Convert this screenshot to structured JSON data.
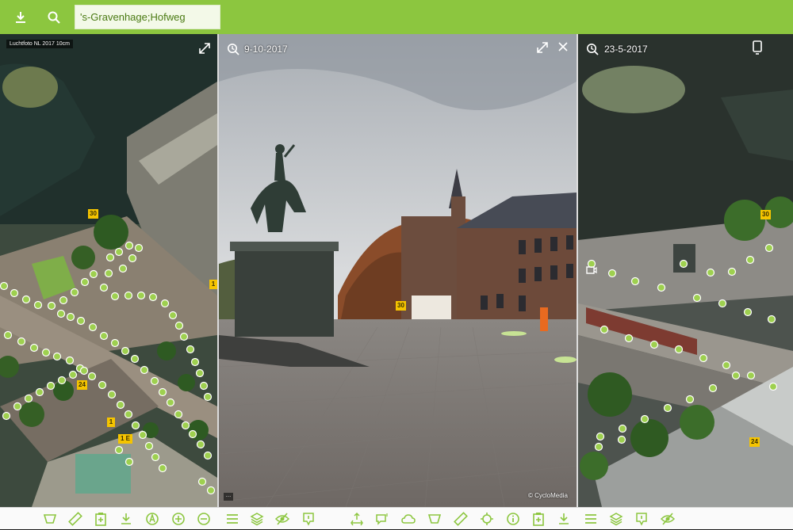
{
  "search": {
    "value": "'s-Gravenhage;Hofweg"
  },
  "left_pane": {
    "layer_label": "Luchtfoto NL 2017 10cm",
    "badges": [
      "30",
      "24",
      "1",
      "1 E",
      "1"
    ]
  },
  "middle_pane": {
    "date": "9-10-2017",
    "copyright": "© CycloMedia",
    "badge": "30"
  },
  "right_pane": {
    "date": "23-5-2017",
    "badges": [
      "30",
      "24"
    ]
  },
  "colors": {
    "accent": "#8cc63f",
    "marker": "#9ed04f",
    "badge": "#f5c400"
  },
  "toolbar": {
    "top_icons": [
      "download-icon",
      "search-icon"
    ],
    "left_icons": [
      "area-measure-icon",
      "ruler-icon",
      "clipboard-icon",
      "download-icon",
      "compass-icon",
      "zoom-in-icon",
      "zoom-out-icon"
    ],
    "middle_icons": [
      "menu-icon",
      "layers-icon",
      "visibility-off-icon",
      "annotation-icon",
      "pan-icon",
      "comment-icon",
      "cloud-icon",
      "area-measure-icon",
      "ruler-icon",
      "locate-icon",
      "info-icon",
      "clipboard-icon",
      "download-icon"
    ],
    "right_icons": [
      "menu-icon",
      "layers-icon",
      "annotation-icon",
      "visibility-off-icon"
    ]
  }
}
